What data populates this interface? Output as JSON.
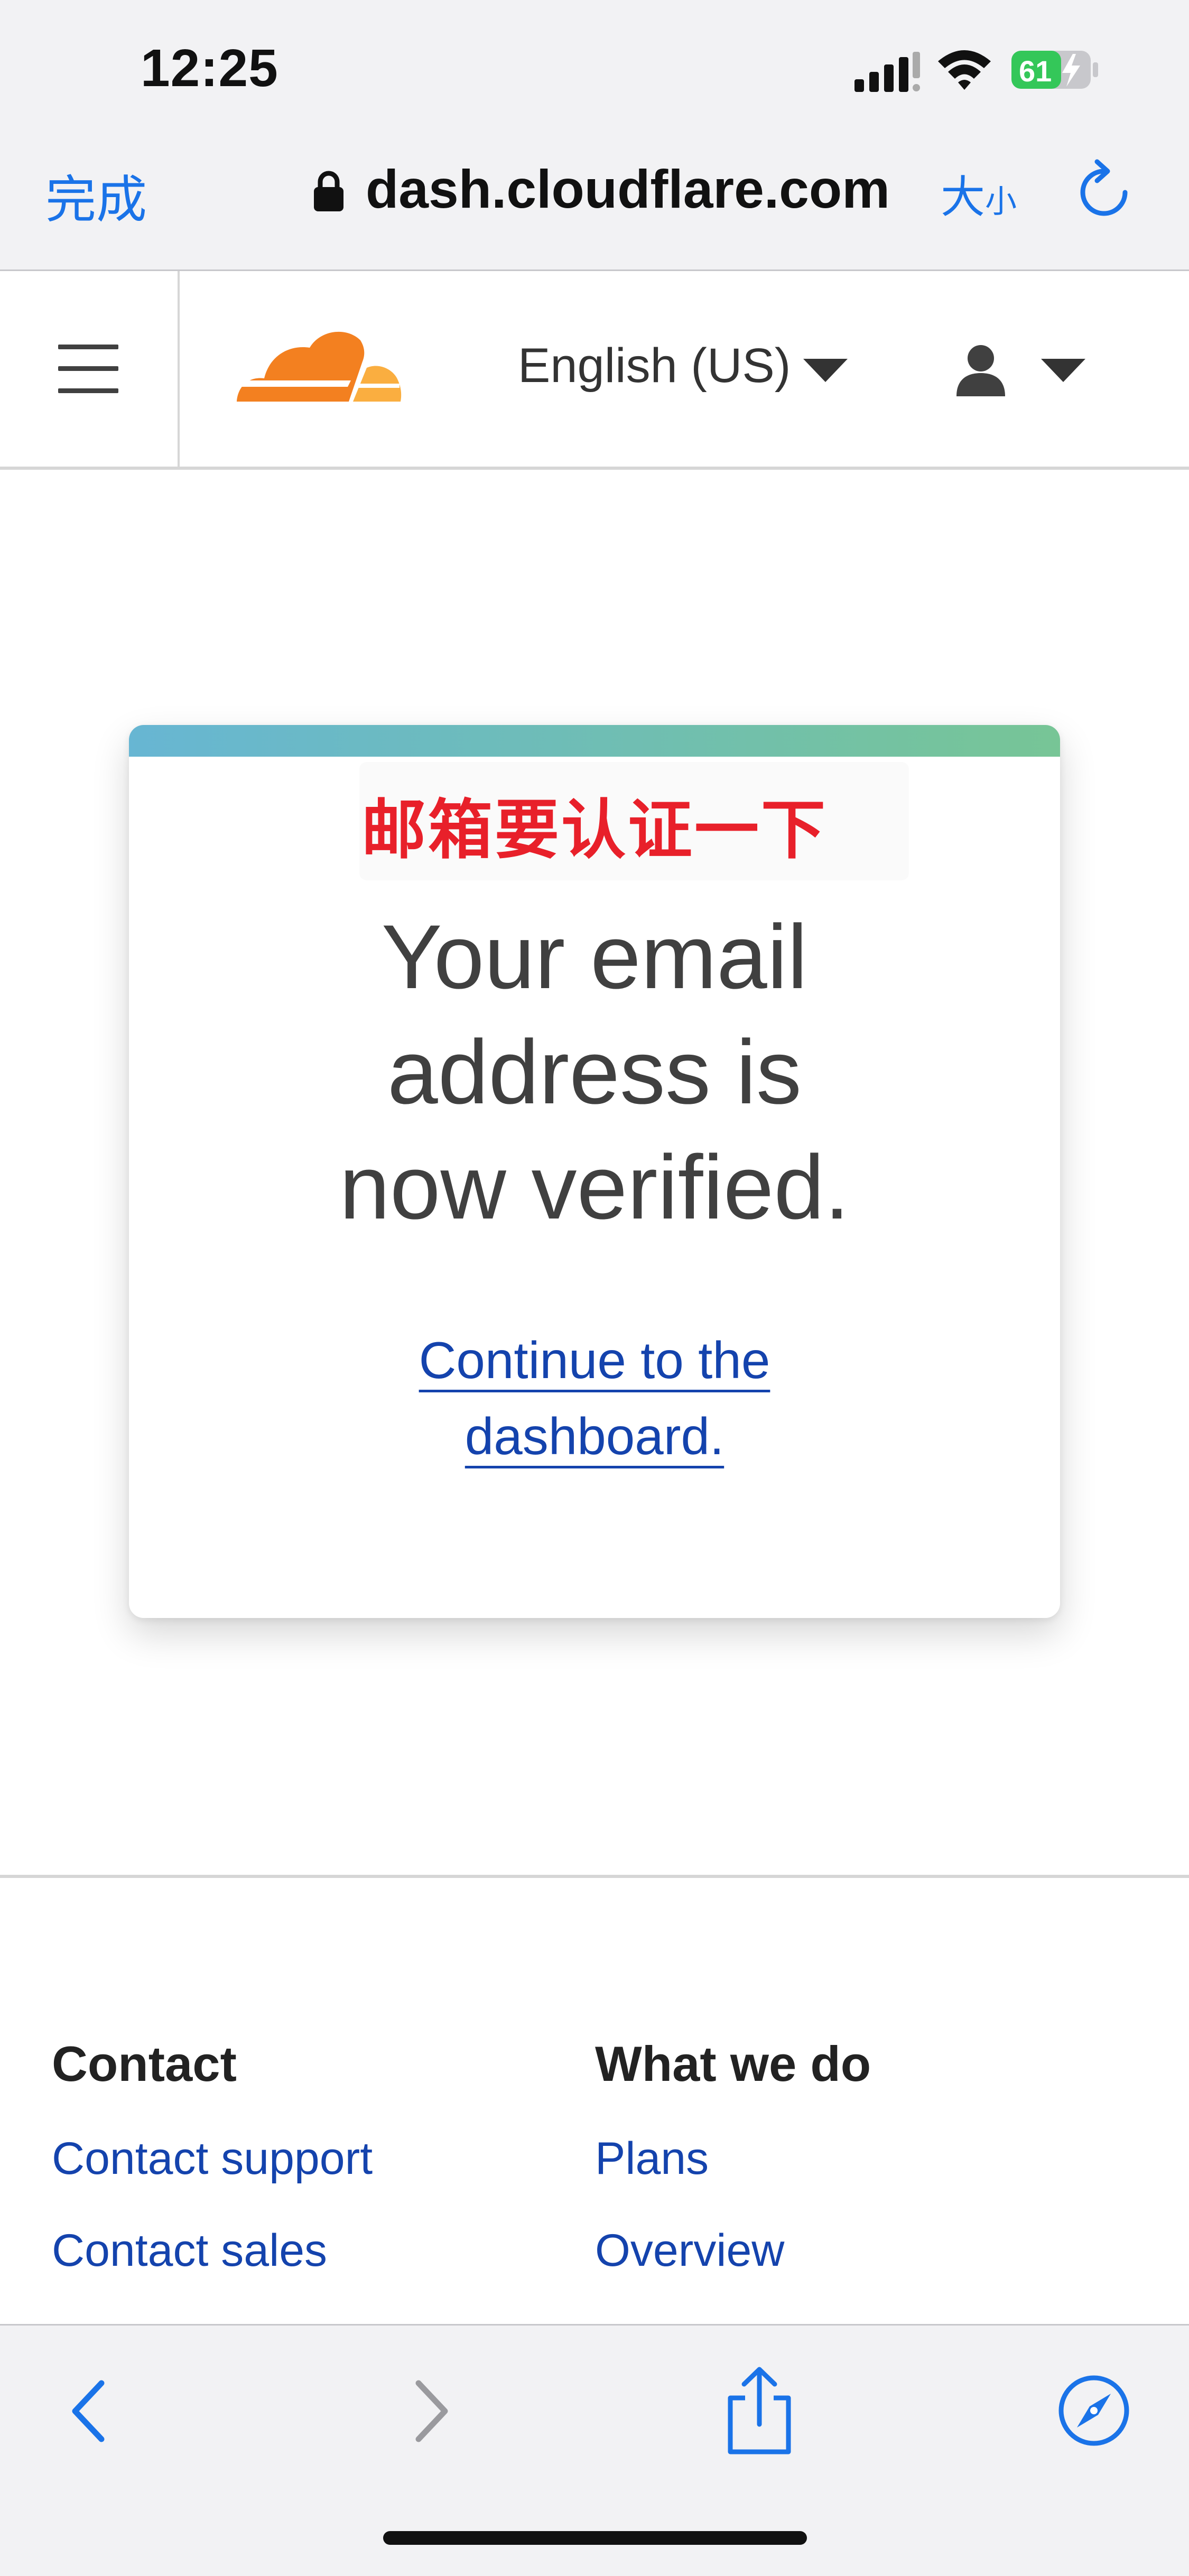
{
  "status_bar": {
    "time": "12:25",
    "battery_percent": "61"
  },
  "browser": {
    "done_label": "完成",
    "url": "dash.cloudflare.com",
    "text_size_big": "大",
    "text_size_small": "小"
  },
  "header": {
    "language": "English (US)",
    "logo_colors": {
      "main": "#f38020",
      "secondary": "#faae40"
    }
  },
  "card": {
    "annotation": "邮箱要认证一下",
    "headline_lines": [
      "Your email",
      "address is",
      "now verified."
    ],
    "link_lines": [
      "Continue to the",
      "dashboard."
    ]
  },
  "footer": {
    "contact_title": "Contact",
    "contact_support": "Contact support",
    "contact_sales": "Contact sales",
    "whatwedo_title": "What we do",
    "plans": "Plans",
    "overview": "Overview"
  },
  "colors": {
    "link": "#1443ad",
    "safari_accent": "#1a73e8",
    "annotation": "#e8202a",
    "battery": "#34c759"
  }
}
